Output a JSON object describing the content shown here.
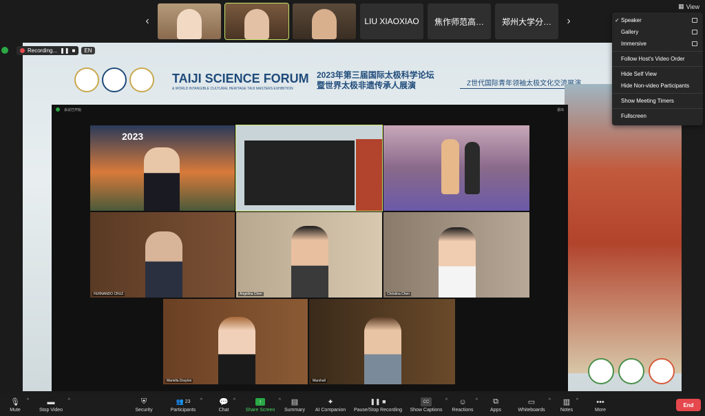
{
  "filmstrip": {
    "prev_icon": "chevron-left-icon",
    "next_icon": "chevron-right-icon",
    "name_tiles": [
      "LIU XIAOXIAO",
      "焦作师范高…",
      "郑州大学分…"
    ]
  },
  "view_button": {
    "label": "View"
  },
  "recording": {
    "label": "Recording...",
    "language": "EN"
  },
  "shared_screen": {
    "forum_title": "TAIJI SCIENCE FORUM",
    "forum_subtitle": "& WORLD INTANGIBLE CULTURAL HERITAGE TAIJI MASTERS EXHIBITION",
    "cn_title_line1": "2023年第三届国际太极科学论坛",
    "cn_title_line2": "暨世界太极非遗传承人展演",
    "cn_right": "Z世代国际青年领袖太极文化交流展演",
    "inner_window_label": "会议已开始",
    "inner_top_right": "退出",
    "year": "2023",
    "tiles": [
      {
        "label": "",
        "kind": "poster"
      },
      {
        "label": "",
        "kind": "screen"
      },
      {
        "label": "",
        "kind": "performance"
      },
      {
        "label": "FERNANDO CRUZ",
        "kind": "person"
      },
      {
        "label": "Angelina Chen",
        "kind": "person"
      },
      {
        "label": "Christina Chen",
        "kind": "person"
      },
      {
        "label": "Mariella Drayton",
        "kind": "person"
      },
      {
        "label": "Marshall",
        "kind": "person"
      }
    ]
  },
  "view_menu": {
    "items": [
      {
        "label": "Speaker",
        "checked": true,
        "icon": "speaker-layout-icon"
      },
      {
        "label": "Gallery",
        "icon": "gallery-layout-icon"
      },
      {
        "label": "Immersive",
        "icon": "immersive-layout-icon"
      },
      {
        "label": "Follow Host's Video Order"
      },
      {
        "label": "Hide Self View"
      },
      {
        "label": "Hide Non-video Participants"
      },
      {
        "label": "Show Meeting Timers"
      },
      {
        "label": "Fullscreen"
      }
    ]
  },
  "toolbar": {
    "mute": "Mute",
    "stop_video": "Stop Video",
    "security": "Security",
    "participants": "Participants",
    "participant_count": "23",
    "chat": "Chat",
    "share_screen": "Share Screen",
    "summary": "Summary",
    "ai_companion": "AI Companion",
    "pause_stop_recording": "Pause/Stop Recording",
    "show_captions": "Show Captions",
    "cc": "CC",
    "reactions": "Reactions",
    "apps": "Apps",
    "whiteboards": "Whiteboards",
    "notes": "Notes",
    "more": "More",
    "end": "End"
  },
  "colors": {
    "accent_green": "#2aa845",
    "end_red": "#e5484d",
    "forum_blue": "#1f4b7a"
  }
}
